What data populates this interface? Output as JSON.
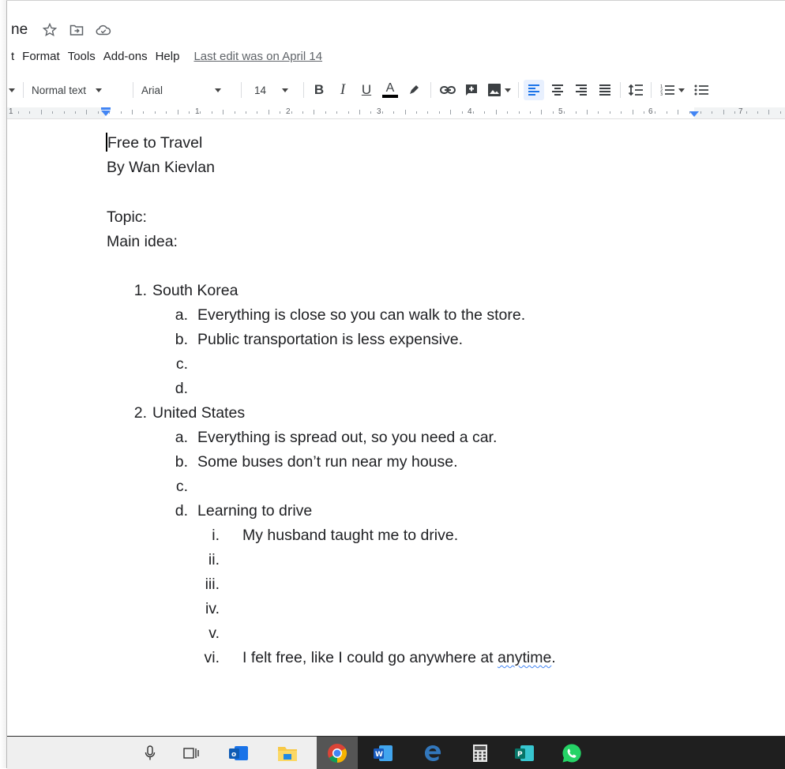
{
  "header": {
    "title": "ne",
    "menu": [
      "t",
      "Format",
      "Tools",
      "Add-ons",
      "Help"
    ],
    "last_edit": "Last edit was on April 14"
  },
  "toolbar": {
    "style": "Normal text",
    "font": "Arial",
    "size": "14",
    "bold": "B",
    "italic": "I",
    "underline": "U",
    "text_color": "A"
  },
  "ruler": {
    "numbers": [
      "1",
      "1",
      "2",
      "3",
      "4",
      "5",
      "6",
      "7"
    ]
  },
  "document": {
    "title": "Free to Travel",
    "byline": "By Wan Kievlan",
    "topic": "Topic:",
    "main_idea": "Main idea:",
    "items": [
      {
        "marker": "1.",
        "text": "South Korea",
        "subs": [
          {
            "marker": "a.",
            "text": "Everything is close so you can walk to the store."
          },
          {
            "marker": "b.",
            "text": "Public transportation is less expensive."
          },
          {
            "marker": "c.",
            "text": ""
          },
          {
            "marker": "d.",
            "text": ""
          }
        ]
      },
      {
        "marker": "2.",
        "text": "United States",
        "subs": [
          {
            "marker": "a.",
            "text": "Everything is spread out, so you need a car."
          },
          {
            "marker": "b.",
            "text": "Some buses don’t run near my house."
          },
          {
            "marker": "c.",
            "text": ""
          },
          {
            "marker": "d.",
            "text": "Learning to drive"
          }
        ],
        "subsubs": [
          {
            "marker": "i.",
            "text": "My husband taught me to drive."
          },
          {
            "marker": "ii.",
            "text": ""
          },
          {
            "marker": "iii.",
            "text": ""
          },
          {
            "marker": "iv.",
            "text": ""
          },
          {
            "marker": "v.",
            "text": ""
          },
          {
            "marker": "vi.",
            "text_before": "I felt free, like I could go anywhere at ",
            "text_spell": "anytime",
            "text_after": "."
          }
        ]
      }
    ]
  },
  "colors": {
    "accent": "#4285f4",
    "align_active_bg": "#e8f0fe",
    "taskbar": "#1f1f1f"
  },
  "taskbar_icons": [
    "microphone-icon",
    "task-view-icon",
    "outlook-icon",
    "file-explorer-icon",
    "chrome-icon",
    "word-icon",
    "edge-icon",
    "calculator-icon",
    "publisher-icon",
    "whatsapp-icon"
  ]
}
